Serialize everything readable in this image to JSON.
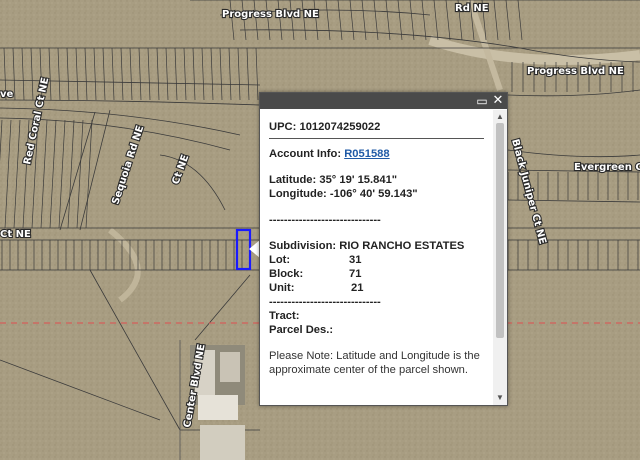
{
  "map": {
    "road_labels": {
      "progress_blvd_top": "Progress Blvd NE",
      "progress_blvd_right": "Progress Blvd NE",
      "rd_ne_top": "Rd NE",
      "red_coral": "Red Coral Ct NE",
      "sequoia": "Sequoia Rd NE",
      "ct_ne_mid": "Ct NE",
      "ct_ne_left": "Ct NE",
      "black_juniper": "Black Juniper Ct NE",
      "evergreen": "Evergreen Ct NE",
      "center_blvd": "Center Blvd NE",
      "ve_left": "ve"
    },
    "colors": {
      "terrain": "#a89d82",
      "parcel_line": "#3a3a3a",
      "selected_parcel": "#1a1aff",
      "boundary_dashed": "#e05050"
    }
  },
  "popup": {
    "upc_label": "UPC:",
    "upc_value": "1012074259022",
    "account_label": "Account Info:",
    "account_value": "R051588",
    "latitude_label": "Latitude:",
    "latitude_value": "35° 19' 15.841\"",
    "longitude_label": "Longitude:",
    "longitude_value": "-106° 40' 59.143\"",
    "separator_1": "------------------------------",
    "subdivision_label": "Subdivision:",
    "subdivision_value": "RIO RANCHO ESTATES",
    "lot_label": "Lot:",
    "lot_value": "31",
    "block_label": "Block:",
    "block_value": "71",
    "unit_label": "Unit:",
    "unit_value": "21",
    "separator_2": "------------------------------",
    "tract_label": "Tract:",
    "parcel_des_label": "Parcel Des.:",
    "note": "Please Note: Latitude and Longitude is the approximate center of the parcel shown.",
    "maximize_icon": "maximize-icon",
    "close_icon": "close-icon"
  }
}
